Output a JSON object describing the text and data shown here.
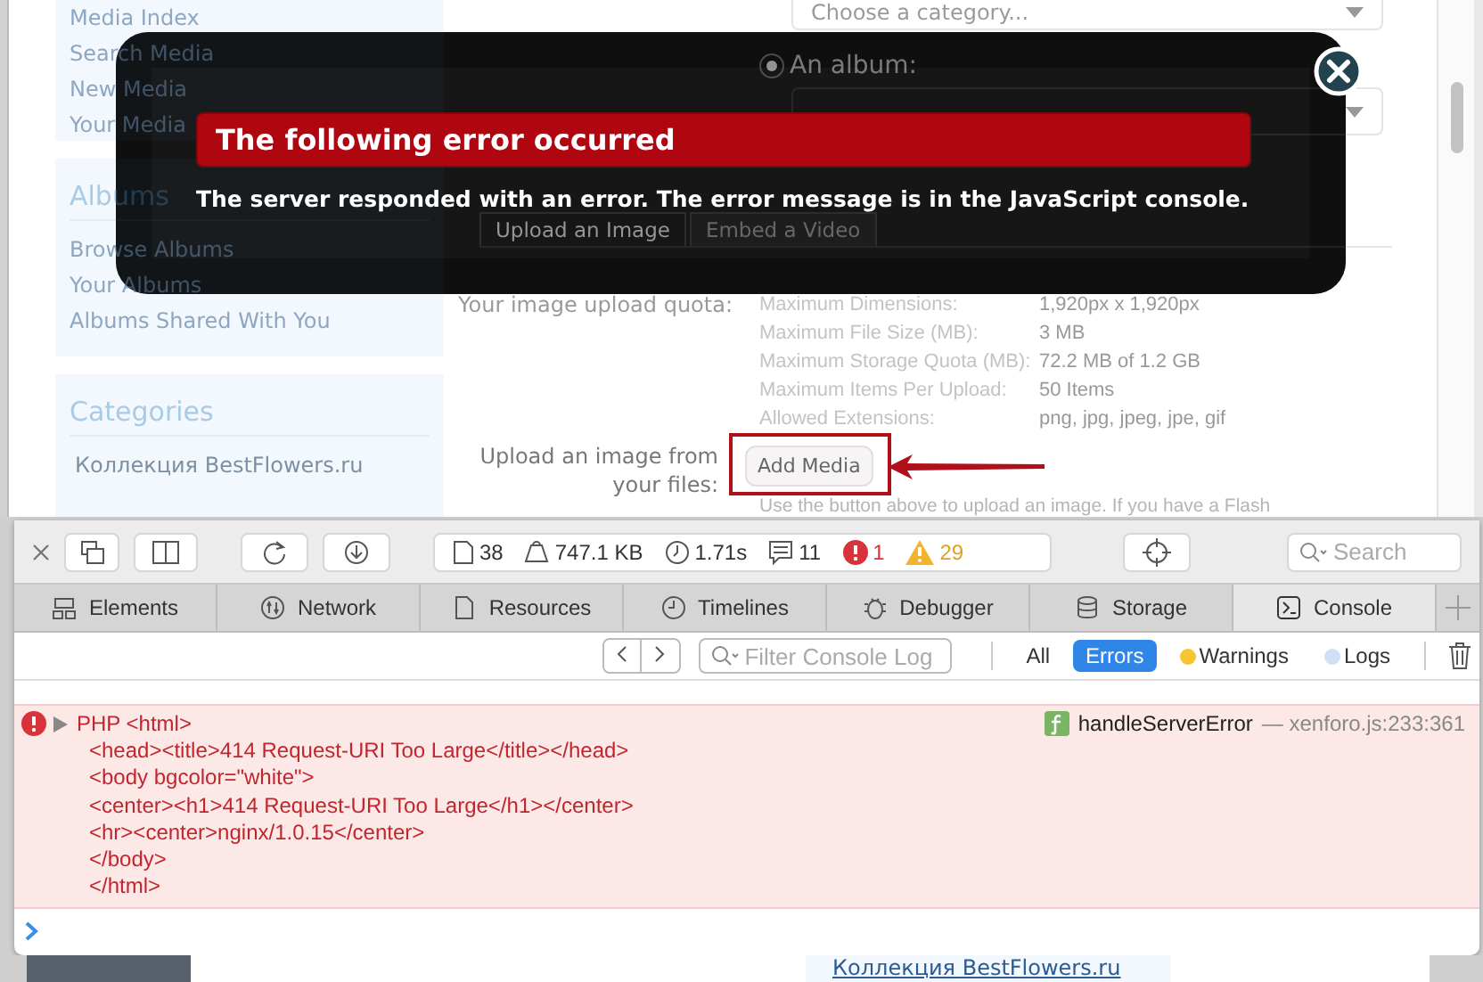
{
  "page": {
    "sidebar": {
      "media_links": [
        "Media Index",
        "Search Media",
        "New Media",
        "Your Media"
      ],
      "albums_heading": "Albums",
      "album_links": [
        "Browse Albums",
        "Your Albums",
        "Albums Shared With You"
      ],
      "categories_heading": "Categories",
      "category_links": [
        "Коллекция BestFlowers.ru"
      ]
    },
    "form": {
      "category_select": {
        "placeholder": "Choose a category..."
      },
      "album_option": {
        "label": "An album:",
        "selected": true
      },
      "tabs": [
        {
          "label": "Upload an Image",
          "selected": true
        },
        {
          "label": "Embed a Video",
          "selected": false
        }
      ],
      "quota_label": "Your image upload quota:",
      "quota": [
        {
          "name": "Maximum Dimensions:",
          "value": "1,920px x 1,920px"
        },
        {
          "name": "Maximum File Size (MB):",
          "value": "3 MB"
        },
        {
          "name": "Maximum Storage Quota (MB):",
          "value": "72.2 MB of 1.2 GB"
        },
        {
          "name": "Maximum Items Per Upload:",
          "value": "50 Items"
        },
        {
          "name": "Allowed Extensions:",
          "value": "png, jpg, jpeg, jpe, gif"
        }
      ],
      "upload_label": "Upload an image from your files:",
      "add_media_button": "Add Media",
      "hint": "Use the button above to upload an image. If you have a Flash"
    }
  },
  "modal": {
    "title": "The following error occurred",
    "message": "The server responded with an error. The error message is in the JavaScript console."
  },
  "devtools": {
    "stats": {
      "resources": "38",
      "size": "747.1 KB",
      "load_time": "1.71s",
      "logs": "11",
      "errors": "1",
      "warnings": "29"
    },
    "search": {
      "placeholder": "Search"
    },
    "tabs": [
      {
        "label": "Elements",
        "selected": false
      },
      {
        "label": "Network",
        "selected": false
      },
      {
        "label": "Resources",
        "selected": false
      },
      {
        "label": "Timelines",
        "selected": false
      },
      {
        "label": "Debugger",
        "selected": false
      },
      {
        "label": "Storage",
        "selected": false
      },
      {
        "label": "Console",
        "selected": true
      }
    ],
    "filter": {
      "placeholder": "Filter Console Log"
    },
    "levels": [
      {
        "label": "All",
        "kind": "plain",
        "selected": false
      },
      {
        "label": "Errors",
        "kind": "plain",
        "selected": true
      },
      {
        "label": "Warnings",
        "kind": "dot",
        "color": "#f7c531",
        "selected": false
      },
      {
        "label": "Logs",
        "kind": "dot",
        "color": "#cfe0f5",
        "selected": false
      }
    ],
    "messages": [
      {
        "kind": "error",
        "lines": [
          "PHP <html>",
          "<head><title>414 Request-URI Too Large</title></head>",
          "<body bgcolor=\"white\">",
          "<center><h1>414 Request-URI Too Large</h1></center>",
          "<hr><center>nginx/1.0.15</center>",
          "</body>",
          "</html>"
        ],
        "function": "handleServerError",
        "location": "— xenforo.js:233:361"
      }
    ]
  },
  "bottom_strip": {
    "category_link": "Коллекция BestFlowers.ru"
  }
}
